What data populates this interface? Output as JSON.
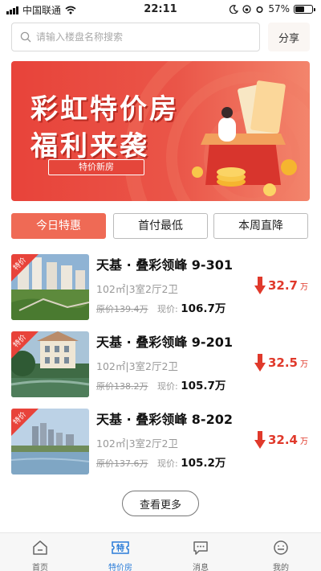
{
  "status_bar": {
    "carrier": "中国联通",
    "time": "22:11",
    "battery": "57%",
    "battery_level": 0.57
  },
  "search": {
    "placeholder": "请输入楼盘名称搜索",
    "share_label": "分享"
  },
  "banner": {
    "title_line1": "彩虹特价房",
    "title_line2": "福利来袭",
    "tag": "特价新房"
  },
  "tabs": [
    {
      "label": "今日特惠",
      "active": true
    },
    {
      "label": "首付最低",
      "active": false
    },
    {
      "label": "本周直降",
      "active": false
    }
  ],
  "listings": [
    {
      "badge": "特价",
      "title": "天基 · 叠彩领峰 9-301",
      "spec": "102㎡|3室2厅2卫",
      "orig_label": "原价",
      "orig_price": "139.4万",
      "now_label": "现价:",
      "now_price": "106.7万",
      "drop_value": "32.7",
      "drop_unit": "万"
    },
    {
      "badge": "特价",
      "title": "天基 · 叠彩领峰 9-201",
      "spec": "102㎡|3室2厅2卫",
      "orig_label": "原价",
      "orig_price": "138.2万",
      "now_label": "现价:",
      "now_price": "105.7万",
      "drop_value": "32.5",
      "drop_unit": "万"
    },
    {
      "badge": "特价",
      "title": "天基 · 叠彩领峰 8-202",
      "spec": "102㎡|3室2厅2卫",
      "orig_label": "原价",
      "orig_price": "137.6万",
      "now_label": "现价:",
      "now_price": "105.2万",
      "drop_value": "32.4",
      "drop_unit": "万"
    }
  ],
  "more_label": "查看更多",
  "nav": [
    {
      "label": "首页",
      "icon": "home-icon",
      "active": false
    },
    {
      "label": "特价房",
      "icon": "special-offer-icon",
      "active": true
    },
    {
      "label": "消息",
      "icon": "message-icon",
      "active": false
    },
    {
      "label": "我的",
      "icon": "profile-icon",
      "active": false
    }
  ],
  "nav_icon_glyph": "特",
  "colors": {
    "accent": "#ef6a55",
    "price_drop": "#e0392b",
    "nav_active": "#2a7cd8",
    "banner": "#e8433a"
  }
}
